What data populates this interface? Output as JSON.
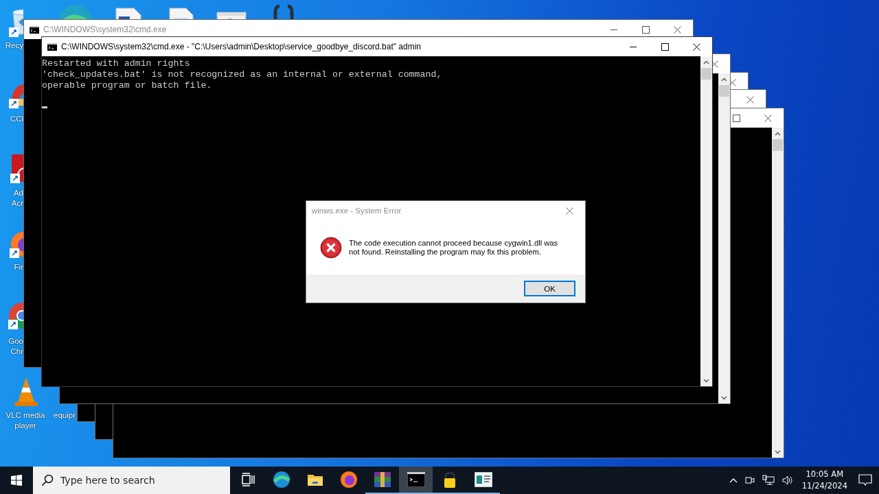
{
  "desktop_icons": [
    {
      "kind": "recycle-bin",
      "label": "Recy"
    },
    {
      "kind": "ccleaner",
      "label": "CCl"
    },
    {
      "kind": "pdf",
      "label": "Ad Acr"
    },
    {
      "kind": "firefox",
      "label": "Fir"
    },
    {
      "kind": "chrome",
      "label": "Goo Chr"
    },
    {
      "kind": "vlc",
      "label": "VLC media player"
    },
    {
      "kind": "blank",
      "label": "equipr"
    },
    {
      "kind": "edge"
    },
    {
      "kind": "word"
    },
    {
      "kind": "document"
    },
    {
      "kind": "settings"
    },
    {
      "kind": "braces"
    }
  ],
  "windows": [
    {
      "title": "C:\\WINDOWS\\system32\\cmd.exe",
      "active": false,
      "controls": [
        {
          "kind": "minimize"
        },
        {
          "kind": "maximize"
        },
        {
          "kind": "close"
        }
      ]
    },
    {
      "title": "C:\\WINDOWS\\system32\\cmd.exe - \"C:\\Users\\admin\\Desktop\\service_goodbye_discord.bat\"  admin",
      "active": true,
      "controls": [
        {
          "kind": "minimize"
        },
        {
          "kind": "maximize"
        },
        {
          "kind": "close"
        }
      ],
      "scrollbar": true,
      "lines": [
        "Restarted with admin rights",
        "'check_updates.bat' is not recognized as an internal or external command,",
        "operable program or batch file."
      ],
      "cursor": true
    },
    {
      "controls": [
        {
          "kind": "close"
        }
      ],
      "scrollbar": true
    },
    {
      "controls": [
        {
          "kind": "close"
        }
      ]
    },
    {
      "controls": [
        {
          "kind": "close"
        }
      ]
    },
    {
      "controls": [
        {
          "kind": "maximize"
        },
        {
          "kind": "close"
        }
      ],
      "scrollbar": true
    }
  ],
  "dialog": {
    "title": "winws.exe - System Error",
    "message": "The code execution cannot proceed because cygwin1.dll was not found. Reinstalling the program may fix this problem.",
    "buttons": [
      {
        "label": "OK",
        "default": true
      }
    ]
  },
  "taskbar": {
    "search": {
      "placeholder": "Type here to search"
    },
    "apps": [
      {
        "kind": "task-view",
        "running": false,
        "active": false
      },
      {
        "kind": "edge",
        "running": false,
        "active": false
      },
      {
        "kind": "explorer",
        "running": false,
        "active": false
      },
      {
        "kind": "firefox",
        "running": false,
        "active": false
      },
      {
        "kind": "winrar",
        "running": true,
        "active": false
      },
      {
        "kind": "console",
        "running": true,
        "active": true
      },
      {
        "kind": "lock",
        "running": true,
        "active": false
      },
      {
        "kind": "document",
        "running": true,
        "active": false
      }
    ],
    "time": "10:05 AM",
    "date": "11/24/2024"
  }
}
